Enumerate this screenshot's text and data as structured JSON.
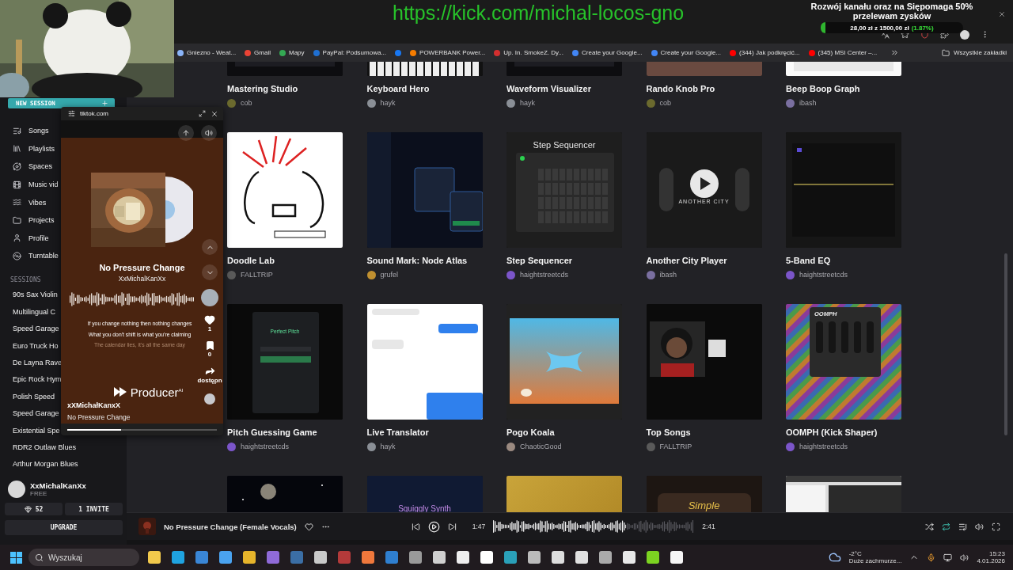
{
  "stream_overlay": {
    "url": "https://kick.com/michal-locos-gno",
    "goal": {
      "title": "Rozwój kanału oraz na Siępomaga 50% przelewam zysków",
      "amount": "28,00 zł z 1500,00 zł",
      "percent": "(1.87%)",
      "level": 0.0187
    }
  },
  "bookmarks": [
    {
      "label": "Gniezno - Weat...",
      "color": "#8ab4f8"
    },
    {
      "label": "Gmail",
      "color": "#ea4335"
    },
    {
      "label": "Mapy",
      "color": "#34a853"
    },
    {
      "label": "PayPal: Podsumowa...",
      "color": "#1f6fd1"
    },
    {
      "color": "#1877f2"
    },
    {
      "label": "POWERBANK Power...",
      "color": "#f57c00"
    },
    {
      "label": "Up. In. SmokeZ. Dy...",
      "color": "#d32f2f"
    },
    {
      "label": "Create your Google...",
      "color": "#4285f4"
    },
    {
      "label": "Create your Google...",
      "color": "#4285f4"
    },
    {
      "label": "(344) Jak podkręcić...",
      "color": "#ff0000"
    },
    {
      "label": "(345) MSI Center –...",
      "color": "#ff0000"
    }
  ],
  "all_bookmarks": "Wszystkie zakładki",
  "sidebar": {
    "new_session": "NEW SESSION",
    "nav": [
      "Songs",
      "Playlists",
      "Spaces",
      "Music vid",
      "Vibes",
      "Projects",
      "Profile",
      "Turntable"
    ],
    "sessions_heading": "SESSIONS",
    "sessions": [
      "90s Sax Violin",
      "Multilingual C",
      "Speed Garage",
      "Euro Truck Ho",
      "De Layna Rave",
      "Epic Rock Hym",
      "Polish Speed",
      "Speed Garage",
      "Existential Spe",
      "RDR2 Outlaw Blues",
      "Arthur Morgan Blues"
    ],
    "user": {
      "name": "XxMichalKanXx",
      "plan": "FREE"
    },
    "credits": "52",
    "invite": "1 INVITE",
    "upgrade": "UPGRADE"
  },
  "grid": [
    {
      "kind": "dark",
      "title": "Mastering Studio",
      "author": "cob",
      "color": "#6b6a2e"
    },
    {
      "kind": "keys",
      "title": "Keyboard Hero",
      "author": "hayk",
      "color": "#8a8f96"
    },
    {
      "kind": "dark",
      "title": "Waveform Visualizer",
      "author": "hayk",
      "color": "#8a8f96"
    },
    {
      "kind": "brown",
      "title": "Rando Knob Pro",
      "author": "cob",
      "color": "#6b6a2e"
    },
    {
      "kind": "white",
      "title": "Beep Boop Graph",
      "author": "ibash",
      "color": "#7a6fa0"
    },
    {
      "kind": "doodle",
      "title": "Doodle Lab",
      "author": "FALLTRIP",
      "color": "#5a5a5a"
    },
    {
      "kind": "nodes",
      "title": "Sound Mark: Node Atlas",
      "author": "grufel",
      "color": "#c09030"
    },
    {
      "kind": "sequencer",
      "thumb_text": "Step Sequencer",
      "title": "Step Sequencer",
      "author": "haightstreetcds",
      "color": "#7b55c9"
    },
    {
      "kind": "player",
      "thumb_text": "ANOTHER CITY",
      "title": "Another City Player",
      "author": "ibash",
      "color": "#7a6fa0"
    },
    {
      "kind": "eq",
      "title": "5-Band EQ",
      "author": "haightstreetcds",
      "color": "#7b55c9"
    },
    {
      "kind": "pitch",
      "thumb_text": "Perfect Pitch",
      "title": "Pitch Guessing Game",
      "author": "haightstreetcds",
      "color": "#7b55c9"
    },
    {
      "kind": "chat",
      "title": "Live Translator",
      "author": "hayk",
      "color": "#8a8f96"
    },
    {
      "kind": "sky",
      "title": "Pogo Koala",
      "author": "ChaoticGood",
      "color": "#9b8a80"
    },
    {
      "kind": "video",
      "title": "Top Songs",
      "author": "FALLTRIP",
      "color": "#5a5a5a"
    },
    {
      "kind": "stripes",
      "thumb_text": "OOMPH",
      "title": "OOMPH (Kick Shaper)",
      "author": "haightstreetcds",
      "color": "#7b55c9"
    },
    {
      "kind": "space"
    },
    {
      "kind": "navy",
      "thumb_text": "Squiggly Synth"
    },
    {
      "kind": "gold"
    },
    {
      "kind": "simple",
      "thumb_text": "Simple"
    },
    {
      "kind": "daw"
    }
  ],
  "popup": {
    "site": "tiktok.com",
    "title": "No Pressure Change",
    "artist": "XxMichalKanXx",
    "lyrics": [
      {
        "text": "If you change nothing then nothing changes",
        "current": true
      },
      {
        "text": "What you don't shift is what you're claiming",
        "current": true
      },
      {
        "text": "The calendar lies, it's all the same day",
        "current": false
      }
    ],
    "likes": "1",
    "saves": "0",
    "share": "dostępn",
    "brand": "Producer",
    "brand_sup": "AI",
    "user": "xXMichałKanxX",
    "song": "No Pressure Change",
    "level": 0.36
  },
  "player": {
    "title": "No Pressure Change (Female Vocals)",
    "elapsed": "1:47",
    "duration": "2:41",
    "level": 0.66,
    "repeat": true
  },
  "taskbar": {
    "search": "Wyszukaj",
    "apps": [
      {
        "color": "#f2c94c"
      },
      {
        "color": "#1fa3e0"
      },
      {
        "color": "#3a86d6"
      },
      {
        "color": "#4aa3f0"
      },
      {
        "color": "#e6b42b"
      },
      {
        "color": "#8f6ad8"
      },
      {
        "color": "#3b6ea5"
      },
      {
        "color": "#c9c9c9"
      },
      {
        "color": "#b33a3a"
      },
      {
        "color": "#f0783c"
      },
      {
        "color": "#2f7fd0"
      },
      {
        "color": "#9a9a9a"
      },
      {
        "color": "#cfcfcf"
      },
      {
        "color": "#eeeeee"
      },
      {
        "color": "#ffffff"
      },
      {
        "color": "#2aa0b8"
      },
      {
        "color": "#bbbbbb"
      },
      {
        "color": "#dddddd"
      },
      {
        "color": "#e0e0e0"
      },
      {
        "color": "#aaaaaa"
      },
      {
        "color": "#e8e8e8"
      },
      {
        "color": "#7cd321"
      },
      {
        "color": "#f5f5f5"
      }
    ],
    "weather": {
      "temp": "-2°C",
      "text": "Duże zachmurze..."
    },
    "time": "15:23",
    "date": "4.01.2026"
  }
}
